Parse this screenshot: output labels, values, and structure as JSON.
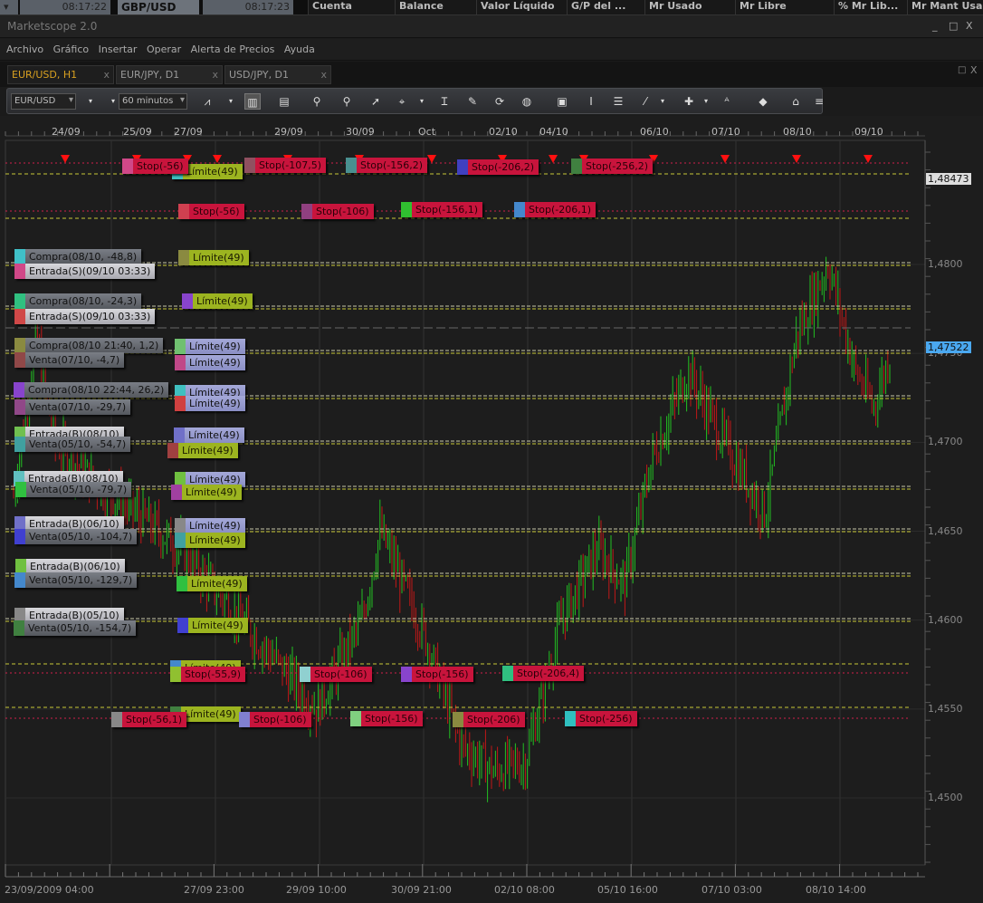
{
  "quotes": {
    "time1": "08:17:22",
    "symbol": "GBP/USD",
    "time2": "08:17:23"
  },
  "account_columns": [
    "Cuenta",
    "Balance",
    "Valor Líquido",
    "G/P del ...",
    "Mr Usado",
    "Mr Libre",
    "% Mr Lib...",
    "Mr Mant Usa"
  ],
  "window": {
    "title": "Marketscope 2.0",
    "minimize": "_",
    "maximize": "□",
    "close": "X"
  },
  "menu": [
    "Archivo",
    "Gráfico",
    "Insertar",
    "Operar",
    "Alerta de Precios",
    "Ayuda"
  ],
  "tabs": [
    {
      "label": "EUR/USD, H1",
      "active": true
    },
    {
      "label": "EUR/JPY, D1"
    },
    {
      "label": "USD/JPY, D1"
    }
  ],
  "tab_close": "x",
  "toolbar": {
    "instrument": "EUR/USD",
    "timeframe": "60 minutos"
  },
  "toolbar_icons": [
    "chart-type-icon",
    "candles-icon",
    "bars-icon",
    "zoom-in-icon",
    "zoom-out-icon",
    "cursor-icon",
    "crosshair-icon",
    "cursor-data-icon",
    "properties-icon",
    "refresh-icon",
    "globe-icon",
    "image-icon",
    "text-icon",
    "report-icon",
    "pen-icon",
    "indicator-icon",
    "abc-icon",
    "eraser-icon",
    "levels-icon",
    "more-icon"
  ],
  "chart": {
    "symbol": "EUR/USD",
    "timeframe": "H1",
    "price_ticks": [
      "1,4800",
      "1,4750",
      "1,4700",
      "1,4650",
      "1,4600",
      "1,4550",
      "1,4500"
    ],
    "price_tick_values": [
      1.48,
      1.475,
      1.47,
      1.465,
      1.46,
      1.455,
      1.45
    ],
    "current_ask": "1,48473",
    "current_bid": "1,47522",
    "top_dates": [
      "24/09",
      "25/09",
      "27/09",
      "29/09",
      "30/09",
      "Oct",
      "02/10",
      "04/10",
      "06/10",
      "07/10",
      "08/10",
      "09/10"
    ],
    "bottom_times": [
      "23/09/2009 04:00",
      "27/09 23:00",
      "29/09 10:00",
      "30/09 21:00",
      "02/10 08:00",
      "05/10 16:00",
      "07/10 03:00",
      "08/10 14:00"
    ],
    "colors": {
      "up": "#22c022",
      "down": "#c01818",
      "stop": "#c8143c",
      "limit": "#9cb420",
      "bid": "#4aa8f0"
    },
    "order_labels": [
      "Stop(-56)",
      "Límite(49)",
      "Stop(-107,5)",
      "Stop(-156,2)",
      "Stop(-206,2)",
      "Stop(-256,2)",
      "Stop(-56)",
      "Stop(-106)",
      "Stop(-156,1)",
      "Stop(-206,1)",
      "Límite(49)",
      "Límite(49)",
      "Compra(08/10, -48,8)",
      "Entrada(S)(09/10 03:33)",
      "Compra(08/10, -24,3)",
      "Entrada(S)(09/10 03:33)",
      "Compra(08/10 21:40, 1,2)",
      "Venta(07/10, -4,7)",
      "Compra(08/10 22:44, 26,2)",
      "Venta(07/10, -29,7)",
      "Entrada(B)(08/10)",
      "Venta(05/10, -54,7)",
      "Entrada(B)(08/10)",
      "Venta(05/10, -79,7)",
      "Entrada(B)(06/10)",
      "Venta(05/10, -104,7)",
      "Entrada(B)(06/10)",
      "Venta(05/10, -129,7)",
      "Entrada(B)(05/10)",
      "Venta(05/10, -154,7)",
      "Límite(49)",
      "Límite(49)",
      "Límite(49)",
      "Límite(49)",
      "Límite(49)",
      "Límite(49)",
      "Límite(49)",
      "Límite(49)",
      "Límite(49)",
      "Límite(49)",
      "Límite(49)",
      "Límite(49)",
      "Límite(49)",
      "Límite(49)",
      "Stop(-55,9)",
      "Stop(-106)",
      "Stop(-156)",
      "Stop(-206,4)",
      "Stop(-56,1)",
      "Stop(-106)",
      "Stop(-156)",
      "Stop(-206)",
      "Stop(-256)"
    ]
  }
}
